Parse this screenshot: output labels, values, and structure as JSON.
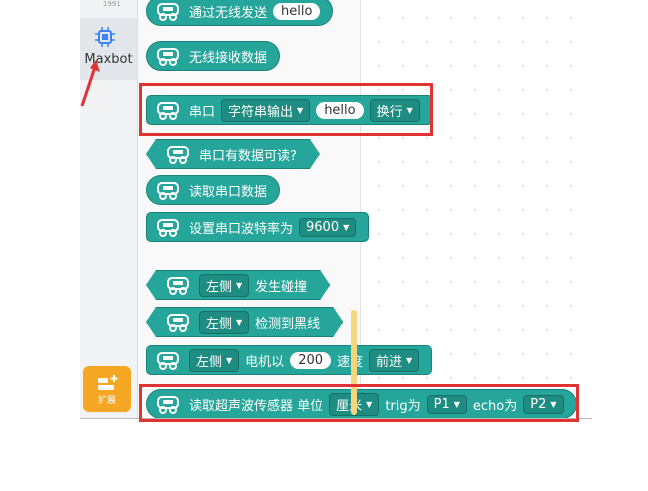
{
  "sidebar": {
    "top_label": "1991",
    "category_label": "Maxbot",
    "extension_label": "扩展"
  },
  "blocks": {
    "b0": {
      "label": "通过无线发送",
      "value": "hello"
    },
    "b1": {
      "label": "无线接收数据"
    },
    "b2": {
      "label": "串口",
      "mode": "字符串输出",
      "value": "hello",
      "newline": "换行"
    },
    "b3": {
      "label": "串口有数据可读?"
    },
    "b4": {
      "label": "读取串口数据"
    },
    "b5": {
      "label": "设置串口波特率为",
      "value": "9600"
    },
    "b6": {
      "side": "左侧",
      "label": "发生碰撞"
    },
    "b7": {
      "side": "左侧",
      "label": "检测到黑线"
    },
    "b8": {
      "side": "左侧",
      "motor": "电机以",
      "speed": "200",
      "speed_label": "速度",
      "direction": "前进"
    },
    "b9": {
      "label": "读取超声波传感器 单位",
      "unit": "厘米",
      "trig_label": "trig为",
      "trig": "P1",
      "echo_label": "echo为",
      "echo": "P2"
    }
  },
  "colors": {
    "block": "#26a69a",
    "highlight": "#e03434",
    "extension": "#f5a623"
  },
  "icons": {
    "robot": "robot-car-icon",
    "chip": "chip-icon",
    "extension": "extension-icon"
  }
}
